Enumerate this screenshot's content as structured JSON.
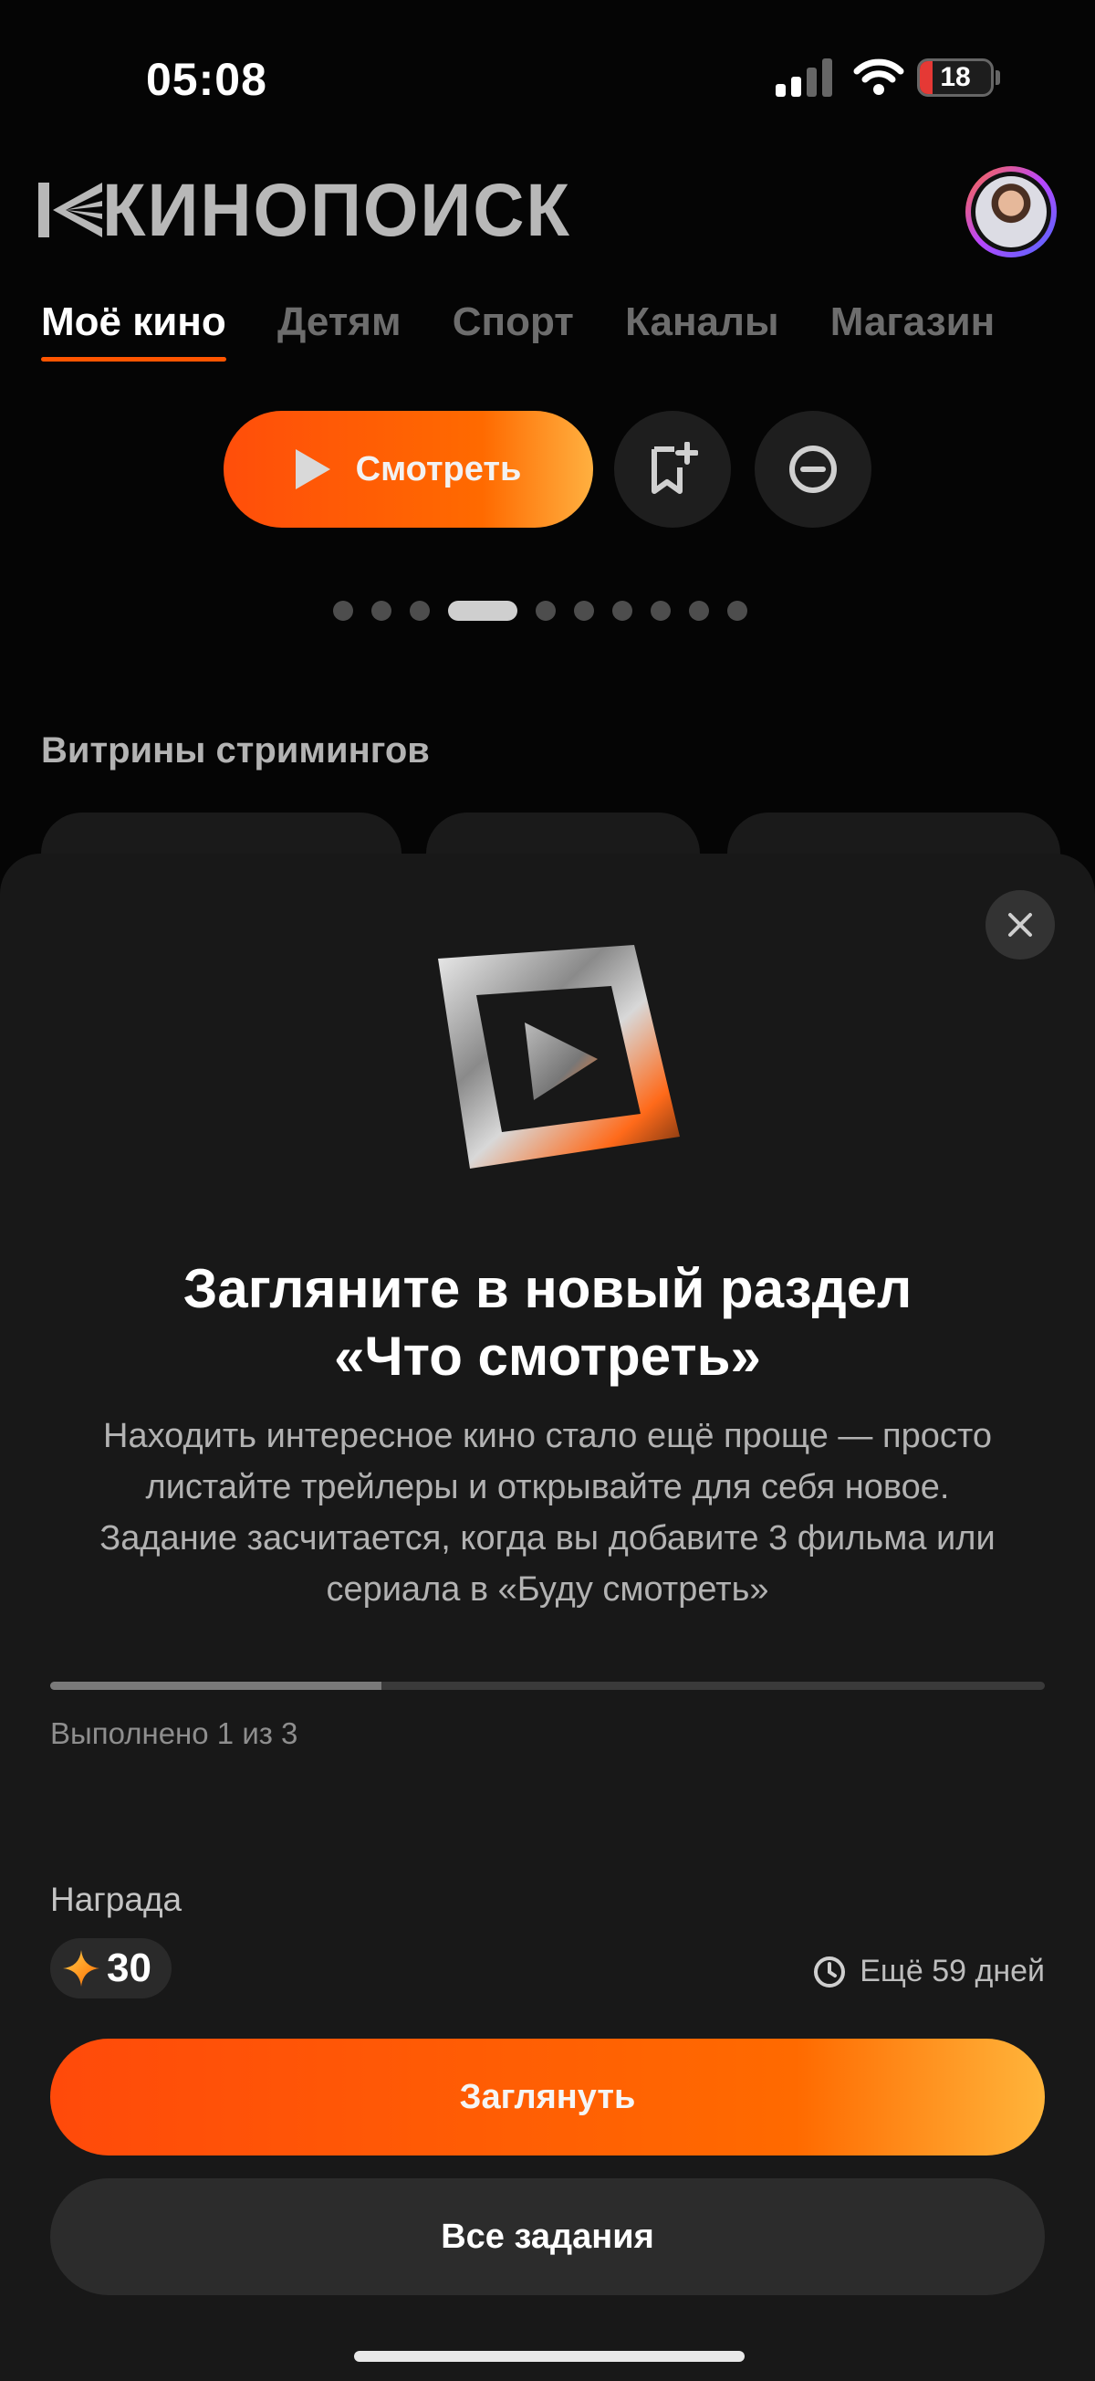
{
  "status_bar": {
    "time": "05:08",
    "battery": "18",
    "battery_level_percent": 18
  },
  "header": {
    "logo": "КИНОПОИСК"
  },
  "tabs": [
    {
      "label": "Моё кино",
      "active": true
    },
    {
      "label": "Детям"
    },
    {
      "label": "Спорт"
    },
    {
      "label": "Каналы"
    },
    {
      "label": "Магазин"
    }
  ],
  "hero": {
    "watch_label": "Смотреть",
    "carousel_active_index": 3,
    "carousel_count": 10
  },
  "section": {
    "title": "Витрины стримингов"
  },
  "sheet": {
    "title_line1": "Загляните в новый раздел",
    "title_line2": "«Что смотреть»",
    "description_lines": [
      "Находить интересное кино стало ещё проще — просто",
      "листайте трейлеры и открывайте для себя новое.",
      "Задание засчитается, когда вы добавите 3 фильма или",
      "сериала в «Буду смотреть»"
    ],
    "progress_text": "Выполнено 1 из 3",
    "progress_done": 1,
    "progress_total": 3,
    "reward_label": "Награда",
    "reward_value": "30",
    "deadline": "Ещё 59 дней",
    "primary_button": "Заглянуть",
    "secondary_button": "Все задания"
  },
  "colors": {
    "accent": "#ff5500",
    "sheet_bg": "#181818",
    "background": "#050505"
  }
}
